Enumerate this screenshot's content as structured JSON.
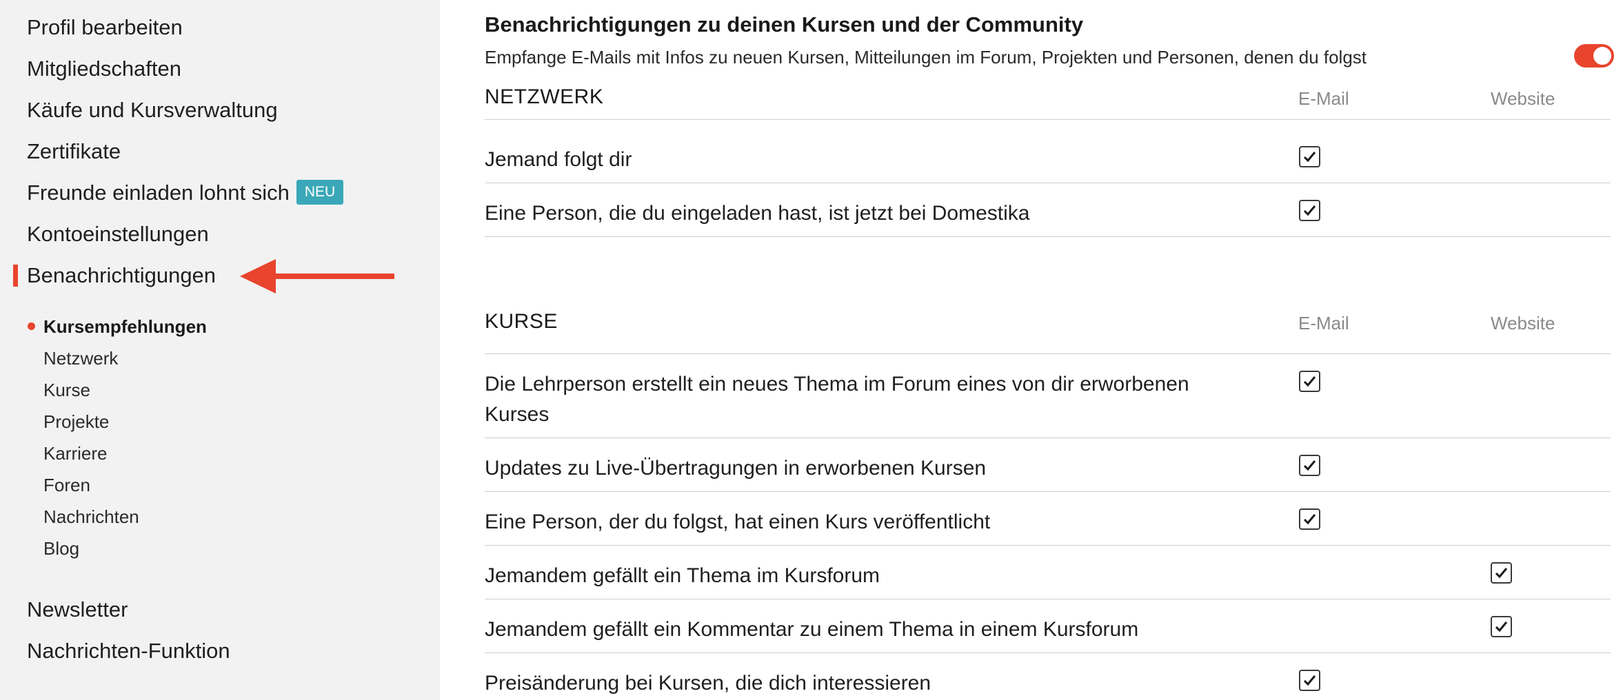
{
  "sidebar": {
    "items": [
      {
        "label": "Profil bearbeiten"
      },
      {
        "label": "Mitgliedschaften"
      },
      {
        "label": "Käufe und Kursverwaltung"
      },
      {
        "label": "Zertifikate"
      },
      {
        "label": "Freunde einladen lohnt sich",
        "badge": "NEU"
      },
      {
        "label": "Kontoeinstellungen"
      },
      {
        "label": "Benachrichtigungen",
        "active": true
      }
    ],
    "subitems": [
      {
        "label": "Kursempfehlungen",
        "current": true
      },
      {
        "label": "Netzwerk"
      },
      {
        "label": "Kurse"
      },
      {
        "label": "Projekte"
      },
      {
        "label": "Karriere"
      },
      {
        "label": "Foren"
      },
      {
        "label": "Nachrichten"
      },
      {
        "label": "Blog"
      }
    ],
    "bottom_items": [
      {
        "label": "Newsletter"
      },
      {
        "label": "Nachrichten-Funktion"
      }
    ],
    "accent_color": "#e8442e",
    "badge_color": "#3aa8b8"
  },
  "main": {
    "title": "Benachrichtigungen zu deinen Kursen und der Community",
    "description": "Empfange E-Mails mit Infos zu neuen Kursen, Mitteilungen im Forum, Projekten und Personen, denen du folgst",
    "toggle_on": true,
    "groups": [
      {
        "title": "NETZWERK",
        "col_email": "E-Mail",
        "col_web": "Website",
        "rows": [
          {
            "label": "Jemand folgt dir",
            "email": true,
            "web": false
          },
          {
            "label": "Eine Person, die du eingeladen hast, ist jetzt bei Domestika",
            "email": true,
            "web": false
          }
        ]
      },
      {
        "title": "KURSE",
        "col_email": "E-Mail",
        "col_web": "Website",
        "rows": [
          {
            "label": "Die Lehrperson erstellt ein neues Thema im Forum eines von dir erworbenen Kurses",
            "email": true,
            "web": false
          },
          {
            "label": "Updates zu Live-Übertragungen in erworbenen Kursen",
            "email": true,
            "web": false
          },
          {
            "label": "Eine Person, der du folgst, hat einen Kurs veröffentlicht",
            "email": true,
            "web": false
          },
          {
            "label": "Jemandem gefällt ein Thema im Kursforum",
            "email": false,
            "web": true
          },
          {
            "label": "Jemandem gefällt ein Kommentar zu einem Thema in einem Kursforum",
            "email": false,
            "web": true
          },
          {
            "label": "Preisänderung bei Kursen, die dich interessieren",
            "email": true,
            "web": false
          }
        ]
      }
    ]
  }
}
